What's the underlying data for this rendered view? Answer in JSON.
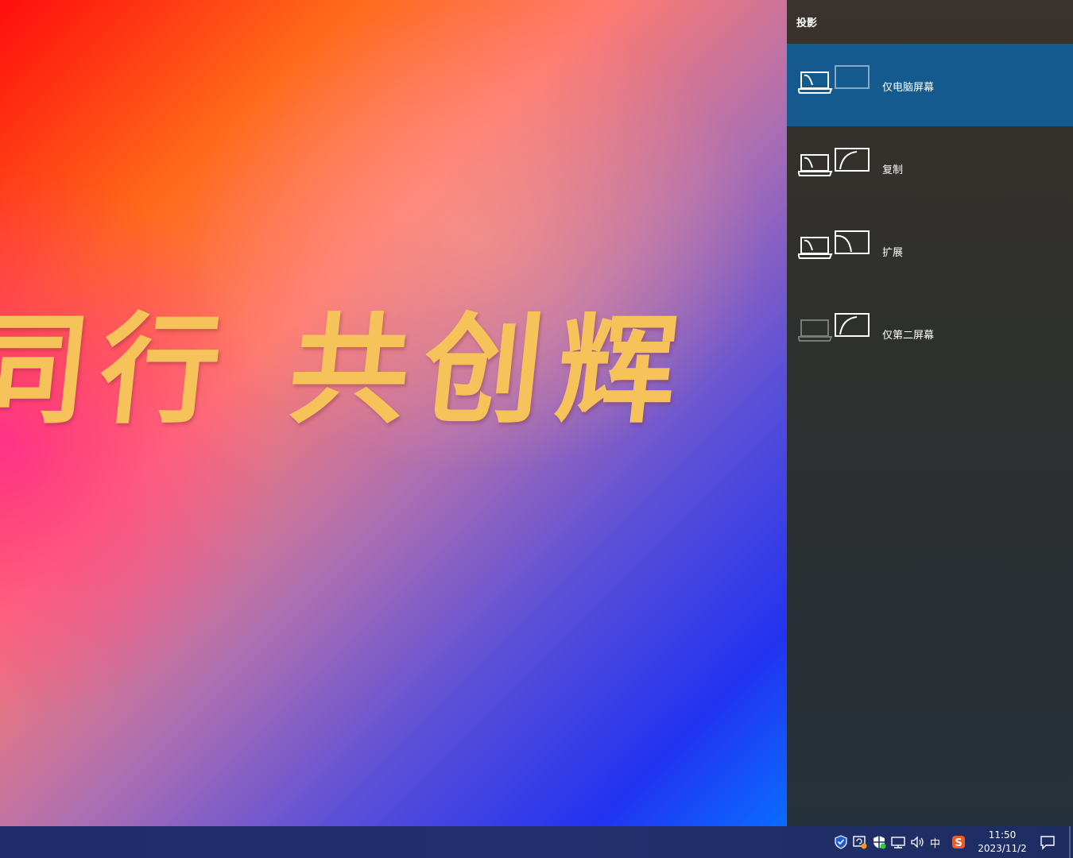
{
  "wallpaper": {
    "text": "同行  共创辉"
  },
  "project_panel": {
    "title": "投影",
    "options": [
      {
        "label": "仅电脑屏幕",
        "selected": true
      },
      {
        "label": "复制",
        "selected": false
      },
      {
        "label": "扩展",
        "selected": false
      },
      {
        "label": "仅第二屏幕",
        "selected": false
      }
    ]
  },
  "taskbar": {
    "ime": "中",
    "time": "11:50",
    "date": "2023/11/2",
    "tray_icons": [
      "security-shield-icon",
      "update-icon",
      "defender-icon",
      "network-icon",
      "volume-icon",
      "sogou-ime-icon"
    ]
  },
  "colors": {
    "selected_option": "#155a8e",
    "panel_background": "#2f302c",
    "wallpaper_text": "#f6c25a"
  }
}
